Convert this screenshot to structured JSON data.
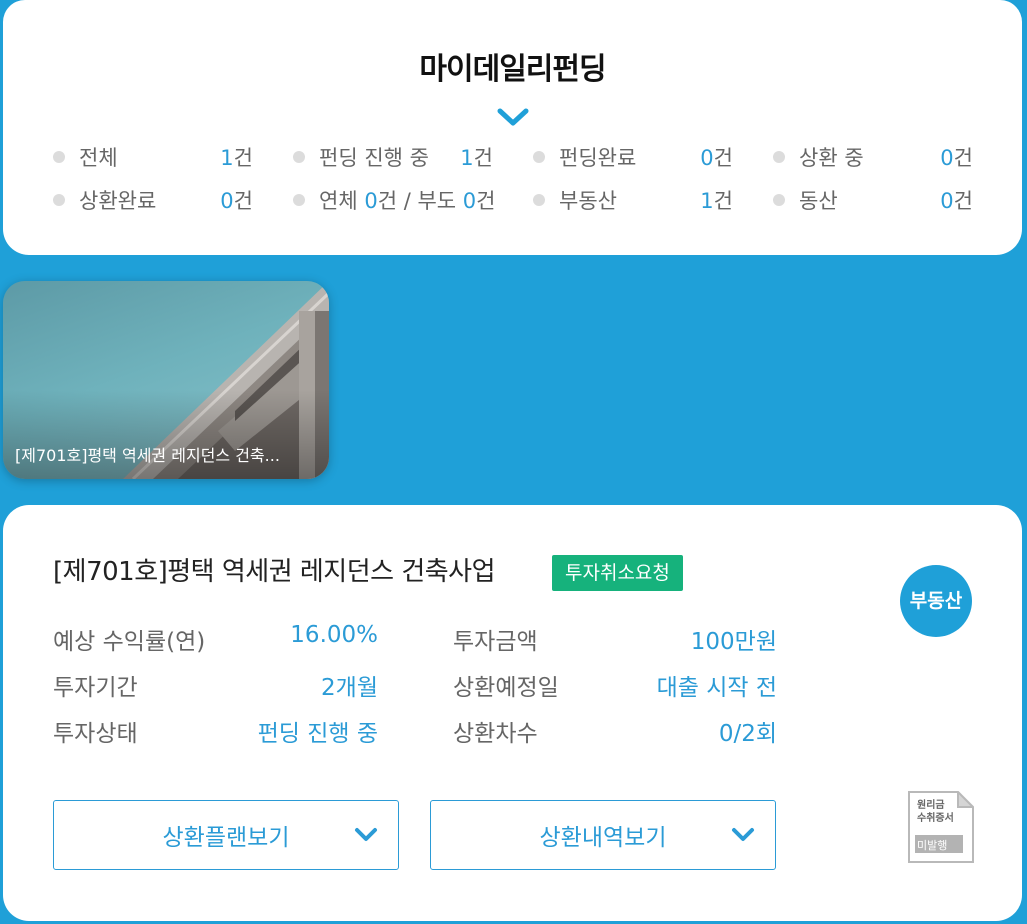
{
  "summary": {
    "title": "마이데일리펀딩",
    "stats_row1": [
      {
        "label": "전체",
        "value": "1",
        "unit": "건"
      },
      {
        "label": "펀딩 진행 중",
        "value": "1",
        "unit": "건"
      },
      {
        "label": "펀딩완료",
        "value": "0",
        "unit": "건"
      },
      {
        "label": "상환 중",
        "value": "0",
        "unit": "건"
      }
    ],
    "stats_row2": [
      {
        "label": "상환완료",
        "value": "0",
        "unit": "건"
      },
      {
        "label": "연체",
        "value": "0",
        "unit": "건",
        "sep": " / ",
        "label2": "부도",
        "value2": "0",
        "unit2": "건"
      },
      {
        "label": "부동산",
        "value": "1",
        "unit": "건"
      },
      {
        "label": "동산",
        "value": "0",
        "unit": "건"
      }
    ]
  },
  "thumbnail": {
    "caption": "[제701호]평택 역세권 레지던스 건축..."
  },
  "detail": {
    "title": "[제701호]평택 역세권 레지던스 건축사업",
    "status_badge": "투자취소요청",
    "type_badge": "부동산",
    "info": {
      "expected_return_label": "예상 수익률(연)",
      "expected_return_value": "16.00%",
      "invest_amount_label": "투자금액",
      "invest_amount_value": "100만원",
      "period_label": "투자기간",
      "period_value": "2개월",
      "repay_date_label": "상환예정일",
      "repay_date_value": "대출 시작 전",
      "invest_status_label": "투자상태",
      "invest_status_value": "펀딩 진행 중",
      "repay_count_label": "상환차수",
      "repay_count_value": "0/2회"
    },
    "buttons": {
      "repay_plan": "상환플랜보기",
      "repay_history": "상환내역보기"
    },
    "receipt": {
      "line1": "원리금",
      "line2": "수취증서",
      "status": "미발행"
    }
  },
  "colors": {
    "background": "#1fa0d8",
    "accent": "#2b9bd6",
    "status_badge": "#16b27c"
  }
}
